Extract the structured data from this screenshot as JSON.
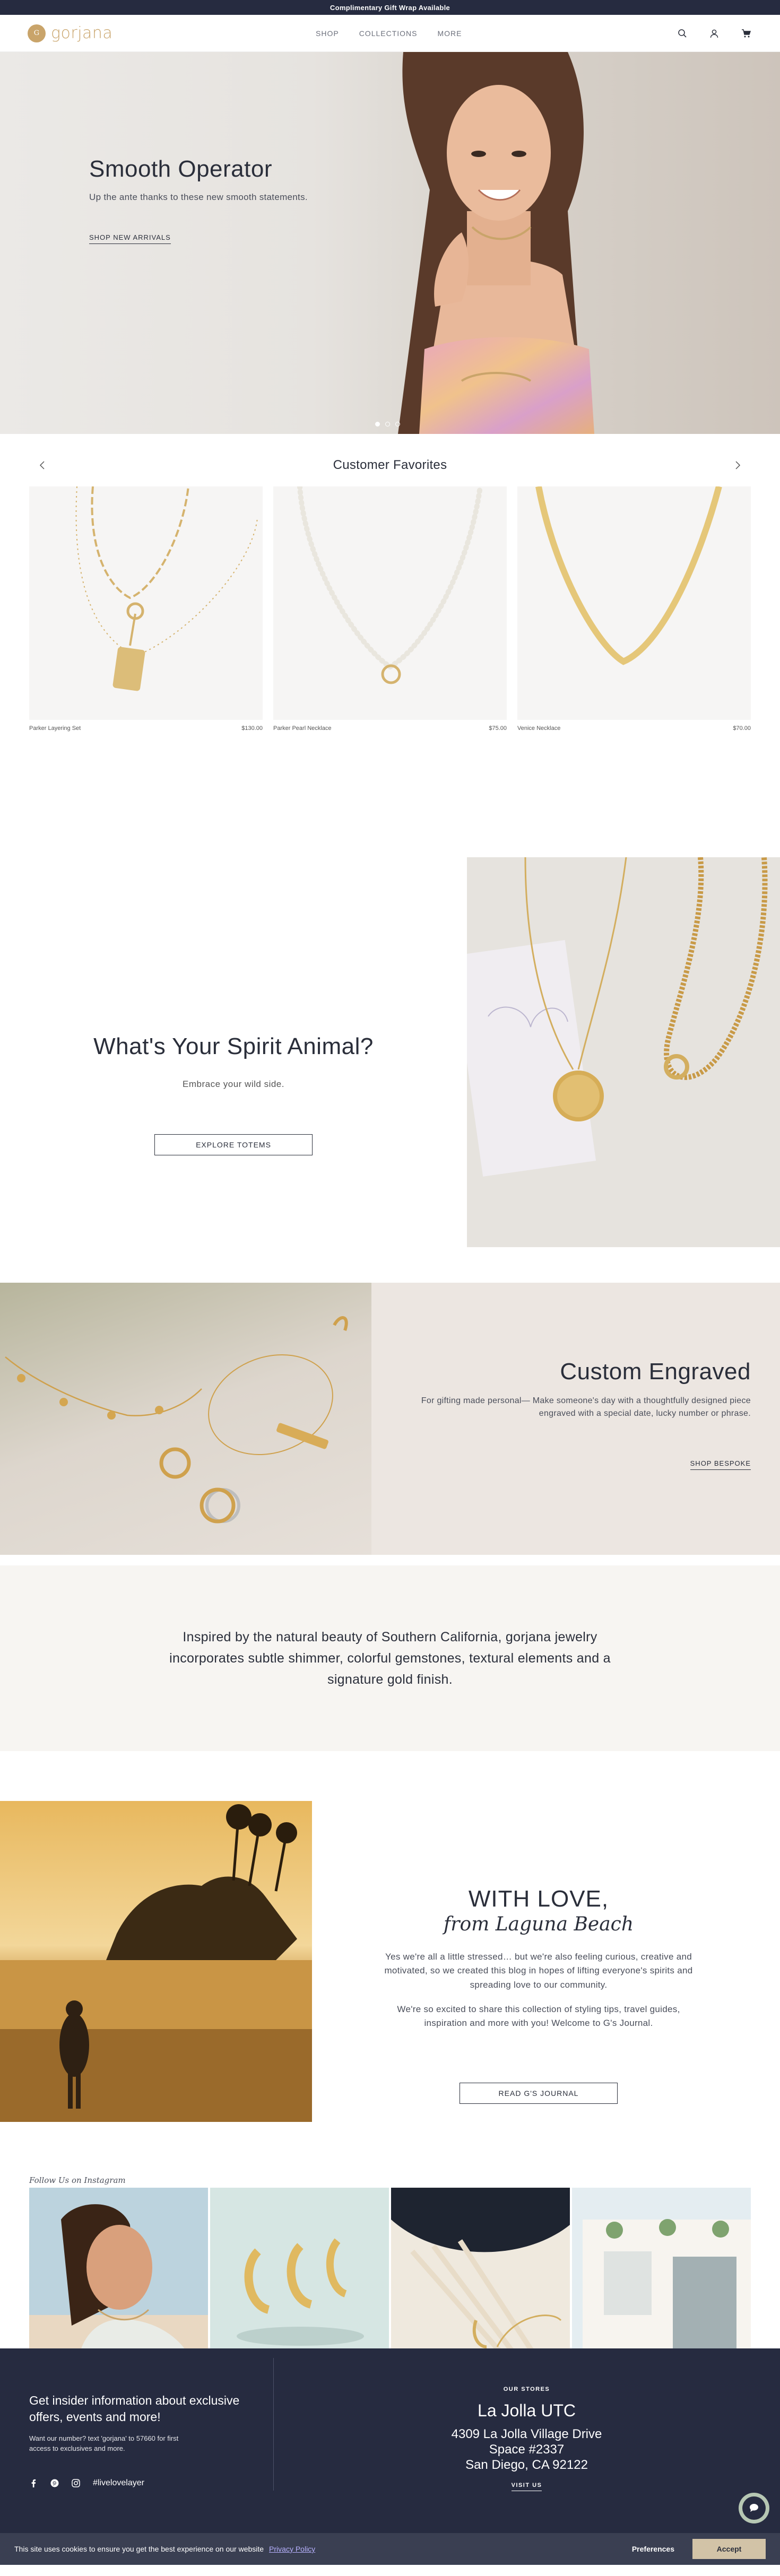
{
  "announcement": "Complimentary Gift Wrap Available",
  "header": {
    "logo_mark": "G",
    "logo_text": "gorjana",
    "nav": [
      "SHOP",
      "COLLECTIONS",
      "MORE"
    ]
  },
  "hero": {
    "title": "Smooth Operator",
    "subtitle": "Up the ante thanks to these new smooth statements.",
    "cta": "SHOP NEW ARRIVALS",
    "slides_total": 3,
    "active_slide": 1
  },
  "favorites": {
    "title": "Customer Favorites",
    "products": [
      {
        "name": "Parker Layering Set",
        "price": "$130.00"
      },
      {
        "name": "Parker Pearl Necklace",
        "price": "$75.00"
      },
      {
        "name": "Venice Necklace",
        "price": "$70.00"
      }
    ]
  },
  "spirit": {
    "title": "What's Your Spirit Animal?",
    "subtitle": "Embrace your wild side.",
    "cta": "EXPLORE TOTEMS"
  },
  "engraved": {
    "title": "Custom Engraved",
    "text": "For gifting made personal— Make someone's day with a thoughtfully designed piece engraved with a special date, lucky number or phrase.",
    "cta": "SHOP BESPOKE"
  },
  "inspired": {
    "text": "Inspired by the natural beauty of Southern California, gorjana jewelry incorporates subtle shimmer, colorful gemstones, textural elements and a signature gold finish."
  },
  "journal": {
    "title": "WITH LOVE,",
    "script": "from Laguna Beach",
    "para1": "Yes we're all a little stressed… but we're also feeling curious, creative and motivated, so we created this blog in hopes of lifting everyone's spirits and spreading love to our community.",
    "para2": "We're so excited to share this collection of styling tips, travel guides, inspiration and more with you! Welcome to G's Journal.",
    "cta": "READ G'S JOURNAL"
  },
  "instagram": {
    "label": "Follow Us on Instagram"
  },
  "footer": {
    "heading": "Get insider information about exclusive offers, events and more!",
    "sms": "Want our number? text 'gorjana' to 57660 for first access to exclusives and more.",
    "hashtag": "#livelovelayer",
    "stores_label": "OUR STORES",
    "store_name": "La Jolla UTC",
    "address_1": "4309 La Jolla Village Drive",
    "address_2": "Space #2337",
    "address_3": "San Diego, CA 92122",
    "visit": "VISIT US"
  },
  "cookie": {
    "message": "This site uses cookies to ensure you get the best experience on our website",
    "policy": "Privacy Policy",
    "preferences": "Preferences",
    "accept": "Accept"
  },
  "colors": {
    "navy": "#262b40",
    "gold": "#c9a46a",
    "cream": "#f7f5f2",
    "accept": "#d2c3a7"
  }
}
